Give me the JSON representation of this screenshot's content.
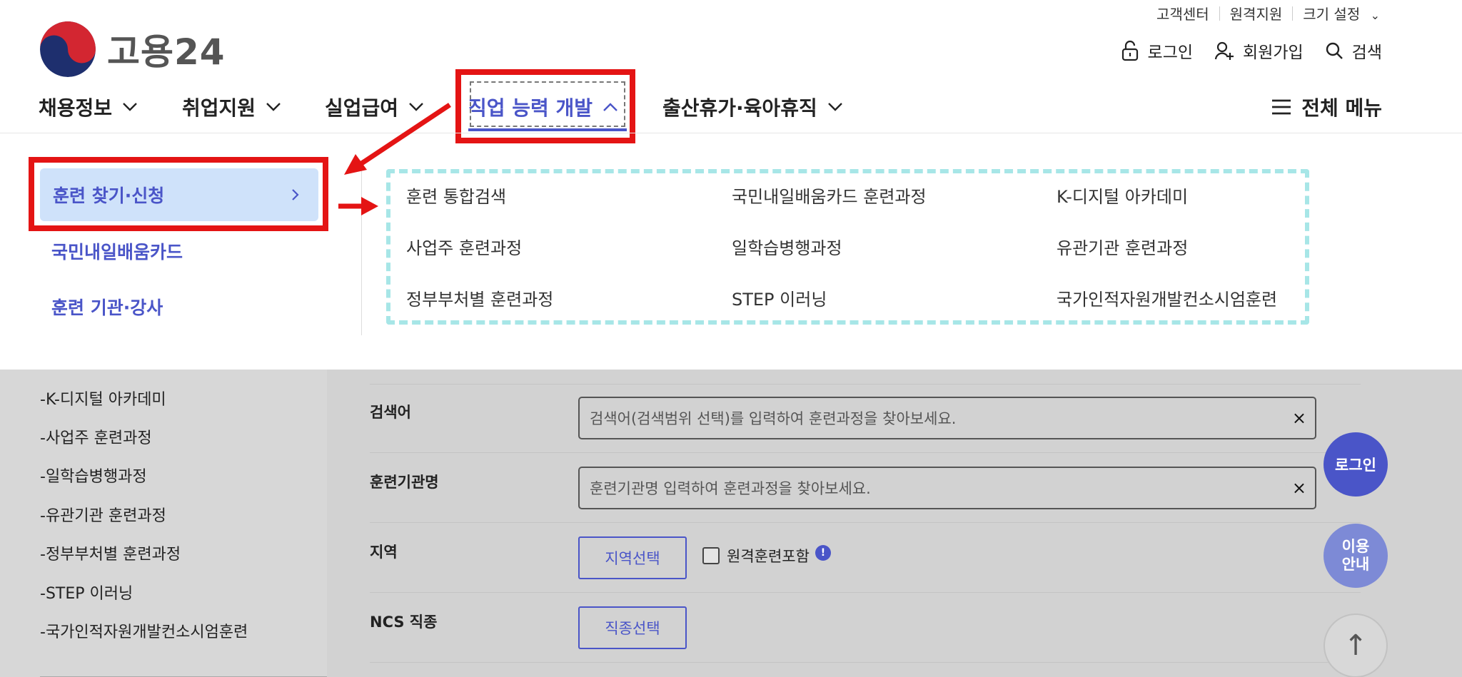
{
  "header": {
    "util_links": [
      "고객센터",
      "원격지원",
      "크기 설정"
    ],
    "logo_text": "고용24",
    "login_label": "로그인",
    "signup_label": "회원가입",
    "search_label": "검색",
    "all_menu_label": "전체 메뉴"
  },
  "gnb": {
    "items": [
      {
        "label": "채용정보"
      },
      {
        "label": "취업지원"
      },
      {
        "label": "실업급여"
      },
      {
        "label": "직업 능력 개발"
      },
      {
        "label": "출산휴가·육아휴직"
      }
    ]
  },
  "dropdown": {
    "lnb": [
      {
        "label": "훈련 찾기·신청"
      },
      {
        "label": "국민내일배움카드"
      },
      {
        "label": "훈련 기관·강사"
      }
    ],
    "sub": [
      {
        "label": "훈련 통합검색"
      },
      {
        "label": "국민내일배움카드 훈련과정"
      },
      {
        "label": "K-디지털 아카데미"
      },
      {
        "label": "사업주 훈련과정"
      },
      {
        "label": "일학습병행과정"
      },
      {
        "label": "유관기관 훈련과정"
      },
      {
        "label": "정부부처별 훈련과정"
      },
      {
        "label": "STEP 이러닝"
      },
      {
        "label": "국가인적자원개발컨소시엄훈련"
      }
    ]
  },
  "sidebar": {
    "items": [
      {
        "label": "-K-디지털 아카데미"
      },
      {
        "label": "-사업주 훈련과정"
      },
      {
        "label": "-일학습병행과정"
      },
      {
        "label": "-유관기관 훈련과정"
      },
      {
        "label": "-정부부처별 훈련과정"
      },
      {
        "label": "-STEP 이러닝"
      },
      {
        "label": "-국가인적자원개발컨소시엄훈련"
      }
    ]
  },
  "form": {
    "keyword_label": "검색어",
    "keyword_placeholder": "검색어(검색범위 선택)를 입력하여 훈련과정을 찾아보세요.",
    "institution_label": "훈련기관명",
    "institution_placeholder": "훈련기관명 입력하여 훈련과정을 찾아보세요.",
    "region_label": "지역",
    "region_button": "지역선택",
    "remote_checkbox": "원격훈련포함",
    "ncs_label": "NCS 직종",
    "ncs_button": "직종선택",
    "clear_symbol": "×"
  },
  "floating": {
    "login": "로그인",
    "guide": "이용\n안내",
    "top": "↑"
  },
  "colors": {
    "accent": "#4a55c8",
    "highlight": "#e41414",
    "dashed_box": "#a7e6e7",
    "active_bg": "#cfe2fa"
  }
}
